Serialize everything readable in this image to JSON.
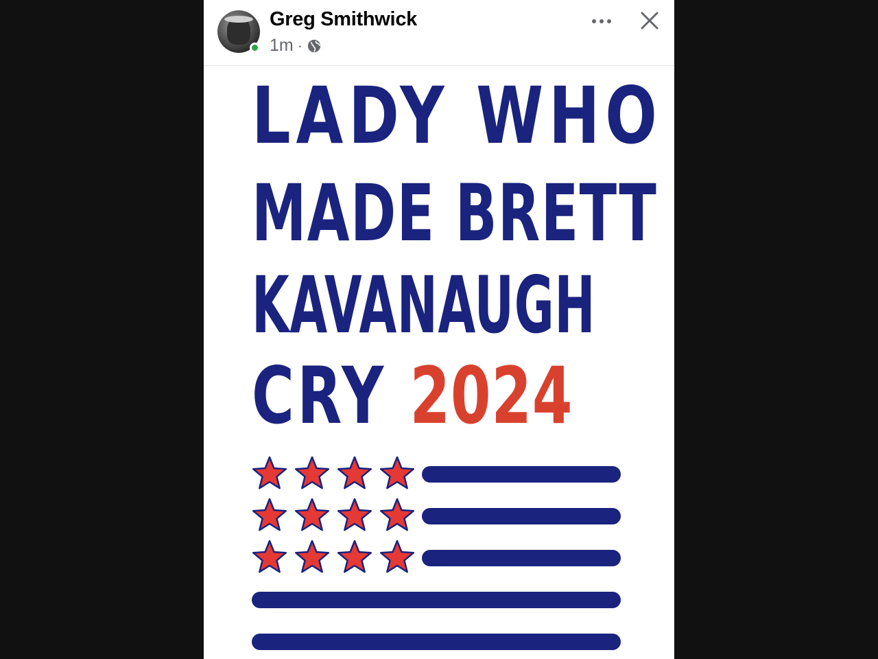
{
  "post": {
    "author": "Greg Smithwick",
    "time": "1m",
    "separator": "·",
    "privacy_icon": "globe-icon",
    "online": true,
    "actions": {
      "more_icon": "more-horizontal-icon",
      "close_icon": "close-icon"
    }
  },
  "image": {
    "lines": [
      "LADY  WHO",
      "MADE BRETT",
      "KAVANAUGH",
      "CRY"
    ],
    "year": "2024",
    "colors": {
      "blue": "#1a237e",
      "red": "#d9412f",
      "star_fill": "#e53935",
      "star_outline": "#1a237e"
    },
    "flag": {
      "star_rows": 3,
      "stars_per_row": 4,
      "short_stripes": 3,
      "long_stripes": 2
    }
  }
}
